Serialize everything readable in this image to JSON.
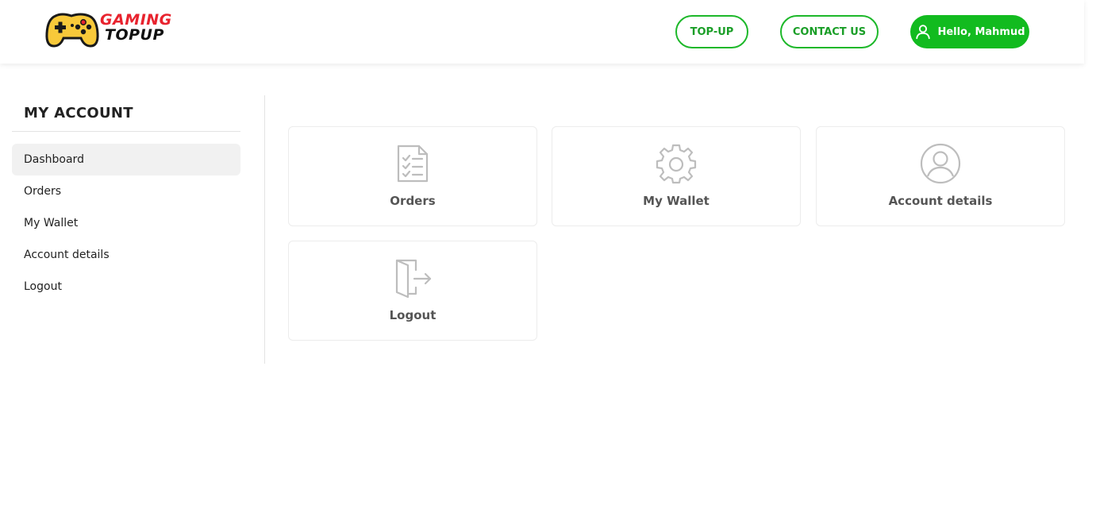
{
  "brand": {
    "line1": "GAMING",
    "line2": "TOPUP",
    "primary_color": "#12bb1f",
    "accent_red": "#e8232e"
  },
  "header": {
    "topup_label": "TOP-UP",
    "contact_label": "CONTACT US",
    "user_label": "Hello, Mahmud",
    "user_icon": "user-icon"
  },
  "sidebar": {
    "title": "MY ACCOUNT",
    "items": [
      {
        "label": "Dashboard",
        "active": true
      },
      {
        "label": "Orders"
      },
      {
        "label": "My Wallet"
      },
      {
        "label": "Account details"
      },
      {
        "label": "Logout"
      }
    ]
  },
  "cards": [
    {
      "label": "Orders",
      "icon": "clipboard-checklist-icon"
    },
    {
      "label": "My Wallet",
      "icon": "gear-icon"
    },
    {
      "label": "Account details",
      "icon": "user-circle-icon"
    },
    {
      "label": "Logout",
      "icon": "exit-door-icon"
    }
  ]
}
